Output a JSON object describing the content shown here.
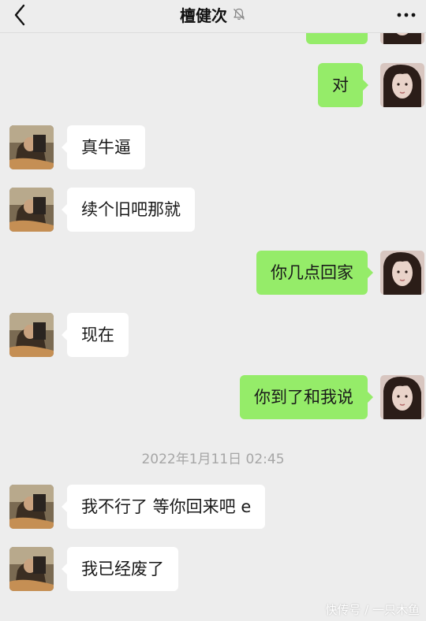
{
  "header": {
    "title": "檀健次",
    "back_icon": "chevron-left-icon",
    "mute_icon": "bell-muted-icon",
    "more_icon": "more-dots-icon"
  },
  "messages": [
    {
      "side": "out",
      "text": ""
    },
    {
      "side": "out",
      "text": "对"
    },
    {
      "side": "in",
      "text": "真牛逼"
    },
    {
      "side": "in",
      "text": "续个旧吧那就"
    },
    {
      "side": "out",
      "text": "你几点回家"
    },
    {
      "side": "in",
      "text": "现在"
    },
    {
      "side": "out",
      "text": "你到了和我说"
    },
    {
      "side": "in",
      "text": "我不行了 等你回来吧 e"
    },
    {
      "side": "in",
      "text": "我已经废了"
    }
  ],
  "timestamp": "2022年1月11日 02:45",
  "watermark": "快传号 / 一只木鱼",
  "colors": {
    "background": "#ededed",
    "outgoing_bubble": "#95ec69",
    "incoming_bubble": "#ffffff"
  }
}
